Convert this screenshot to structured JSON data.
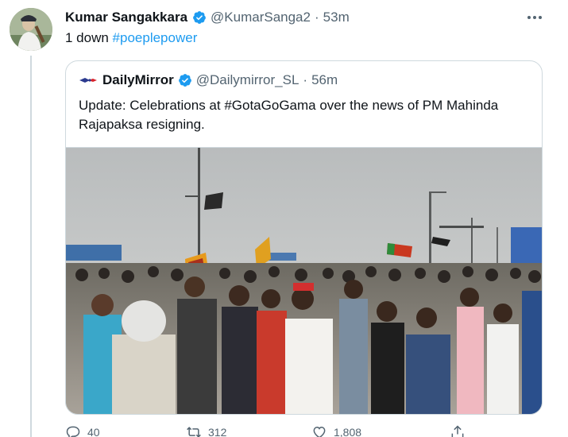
{
  "tweet": {
    "author_name": "Kumar Sangakkara",
    "author_handle": "@KumarSanga2",
    "separator": "·",
    "time": "53m",
    "text_plain": "1 down ",
    "hashtag": "#poeplepower",
    "verified_icon": "verified-badge-icon",
    "more_icon": "more-options-icon"
  },
  "quote": {
    "author_name": "DailyMirror",
    "author_handle": "@Dailymirror_SL",
    "separator": "·",
    "time": "56m",
    "text_line1": "Update: Celebrations at #GotaGoGama over the news of PM Mahinda",
    "text_line2": "Rajapaksa resigning.",
    "media_description_icon": "crowd-photo"
  },
  "actions": {
    "reply_count": "40",
    "retweet_count": "312",
    "like_count": "1,808"
  },
  "colors": {
    "accent": "#1d9bf0",
    "text": "#0f1419",
    "secondary": "#536471",
    "border": "#cfd9de"
  }
}
